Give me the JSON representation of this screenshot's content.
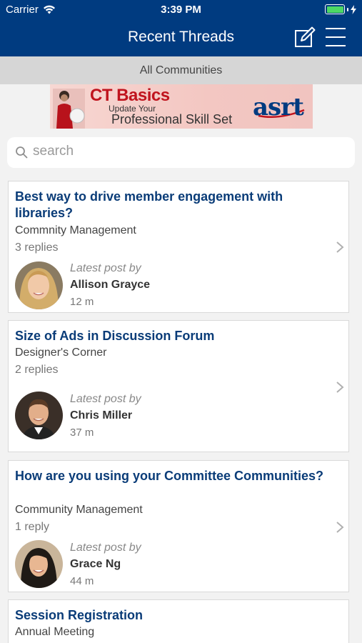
{
  "status_bar": {
    "carrier": "Carrier",
    "time": "3:39 PM"
  },
  "nav": {
    "title": "Recent Threads"
  },
  "filter": {
    "label": "All Communities"
  },
  "ad": {
    "headline": "CT Basics",
    "line1": "Update Your",
    "line2": "Professional Skill Set",
    "logo": "asrt"
  },
  "search": {
    "placeholder": "search"
  },
  "latest_post_label": "Latest post by",
  "threads": [
    {
      "title": "Best way to drive member engagement with libraries?",
      "community": "Commnity Management",
      "replies": "3 replies",
      "author": "Allison Grayce",
      "time": "12 m"
    },
    {
      "title": "Size of Ads in Discussion Forum",
      "community": "Designer's Corner",
      "replies": "2 replies",
      "author": "Chris Miller",
      "time": "37 m"
    },
    {
      "title": "How are you using your Committee Communities?",
      "community": "Community Management",
      "replies": "1 reply",
      "author": "Grace Ng",
      "time": "44 m"
    },
    {
      "title": "Session Registration",
      "community": "Annual Meeting"
    }
  ],
  "colors": {
    "brand": "#003b80",
    "title_text": "#0a3c78",
    "battery": "#4cd964",
    "ad_red": "#c0141e"
  }
}
